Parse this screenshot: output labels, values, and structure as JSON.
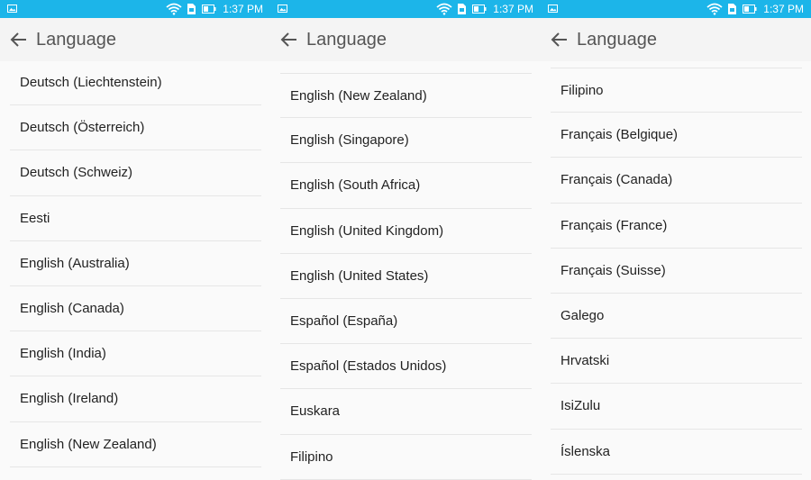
{
  "colors": {
    "status_bar": "#1cb5e9",
    "app_bar": "#f4f4f4",
    "text": "#222222",
    "title": "#555555"
  },
  "status_bar": {
    "time": "1:37 PM",
    "icons": [
      "image-notification-icon",
      "wifi-icon",
      "sim-icon",
      "battery-icon"
    ]
  },
  "screens": [
    {
      "title": "Language",
      "items": [
        "Deutsch (Liechtenstein)",
        "Deutsch (Österreich)",
        "Deutsch (Schweiz)",
        "Eesti",
        "English (Australia)",
        "English (Canada)",
        "English (India)",
        "English (Ireland)",
        "English (New Zealand)"
      ]
    },
    {
      "title": "Language",
      "items": [
        "English (New Zealand)",
        "English (Singapore)",
        "English (South Africa)",
        "English (United Kingdom)",
        "English (United States)",
        "Español (España)",
        "Español (Estados Unidos)",
        "Euskara",
        "Filipino"
      ]
    },
    {
      "title": "Language",
      "items": [
        "Filipino",
        "Français (Belgique)",
        "Français (Canada)",
        "Français (France)",
        "Français (Suisse)",
        "Galego",
        "Hrvatski",
        "IsiZulu",
        "Íslenska"
      ]
    }
  ]
}
